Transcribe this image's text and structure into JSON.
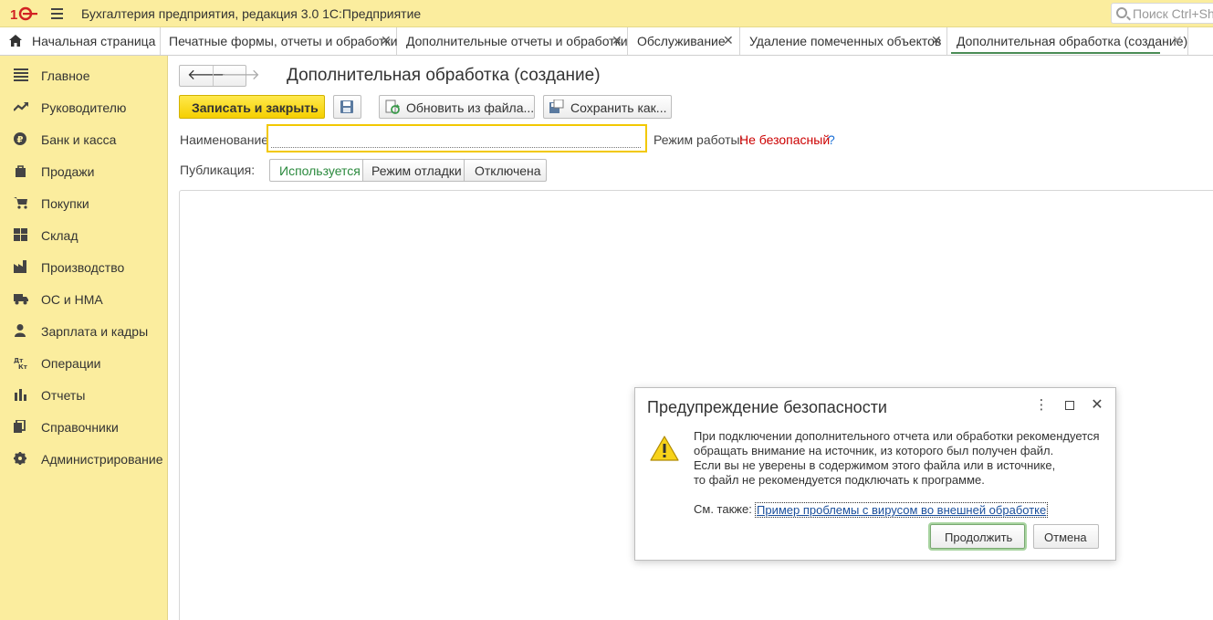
{
  "app": {
    "title": "Бухгалтерия предприятия, редакция 3.0 1С:Предприятие",
    "search_placeholder": "Поиск Ctrl+Shift+F"
  },
  "tabs": [
    {
      "label": "Начальная страница",
      "closable": false
    },
    {
      "label": "Печатные формы, отчеты и обработки",
      "closable": true
    },
    {
      "label": "Дополнительные отчеты и обработки",
      "closable": true
    },
    {
      "label": "Обслуживание",
      "closable": true
    },
    {
      "label": "Удаление помеченных объектов",
      "closable": true
    },
    {
      "label": "Дополнительная обработка (создание)",
      "closable": true,
      "active": true
    }
  ],
  "tab_close_glyph": "✕",
  "sidebar": {
    "items": [
      {
        "label": "Главное",
        "icon": "list-icon"
      },
      {
        "label": "Руководителю",
        "icon": "trend-icon"
      },
      {
        "label": "Банк и касса",
        "icon": "ruble-icon"
      },
      {
        "label": "Продажи",
        "icon": "bag-icon"
      },
      {
        "label": "Покупки",
        "icon": "cart-icon"
      },
      {
        "label": "Склад",
        "icon": "warehouse-icon"
      },
      {
        "label": "Производство",
        "icon": "factory-icon"
      },
      {
        "label": "ОС и НМА",
        "icon": "truck-icon"
      },
      {
        "label": "Зарплата и кадры",
        "icon": "person-icon"
      },
      {
        "label": "Операции",
        "icon": "dt-kt-icon"
      },
      {
        "label": "Отчеты",
        "icon": "bar-chart-icon"
      },
      {
        "label": "Справочники",
        "icon": "books-icon"
      },
      {
        "label": "Администрирование",
        "icon": "gear-icon"
      }
    ]
  },
  "form": {
    "title": "Дополнительная обработка (создание)",
    "toolbar": {
      "save_close": "Записать и закрыть",
      "update_from_file": "Обновить из файла...",
      "save_as": "Сохранить как..."
    },
    "name_label": "Наименование:",
    "name_value": "",
    "mode_label": "Режим работы:",
    "mode_value": "Не безопасный",
    "help": "?",
    "publication_label": "Публикация:",
    "publication_options": [
      "Используется",
      "Режим отладки",
      "Отключена"
    ],
    "publication_selected": "Используется"
  },
  "dialog": {
    "title": "Предупреждение безопасности",
    "lines": [
      "При подключении дополнительного отчета или обработки рекомендуется",
      "обращать внимание на источник, из которого был получен файл.",
      "Если вы не уверены в содержимом этого файла или в источнике,",
      "то файл не рекомендуется подключать к программе."
    ],
    "see_also": "См. также:",
    "link": "Пример проблемы с вирусом во внешней обработке",
    "continue": "Продолжить",
    "cancel": "Отмена"
  },
  "colors": {
    "titlebar_bg": "#fbed9e",
    "primary_button": "#f5cf00",
    "danger_text": "#cc0000",
    "active_accent": "#4a8c55"
  }
}
